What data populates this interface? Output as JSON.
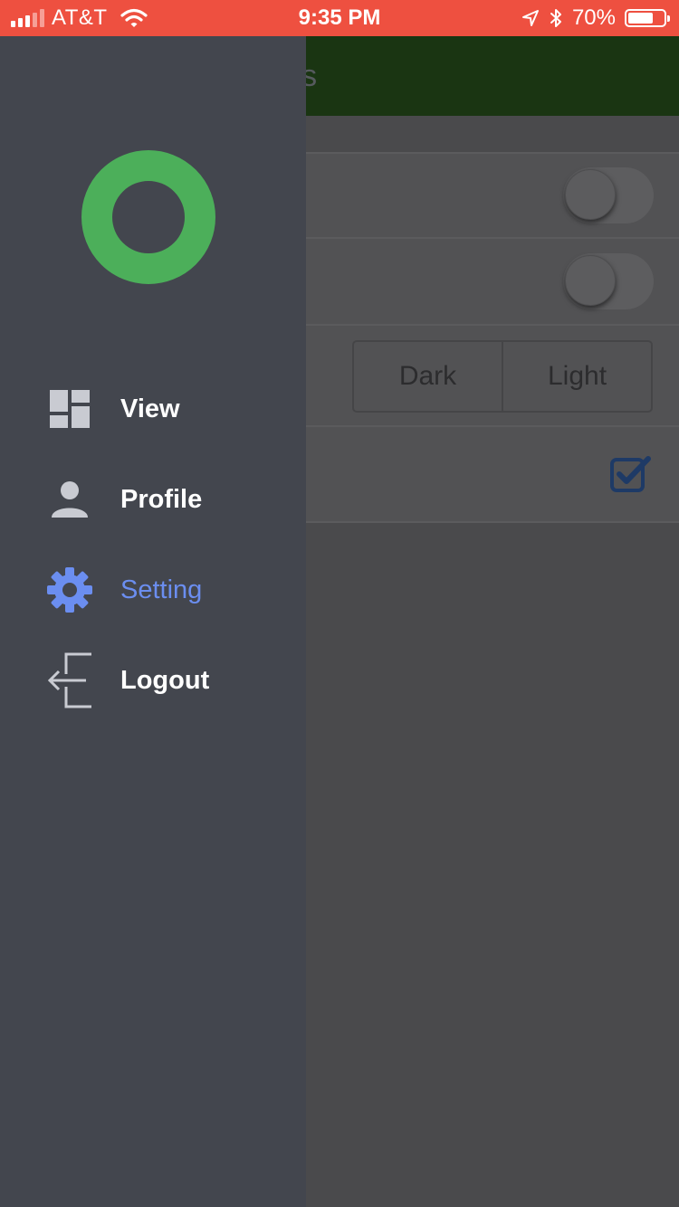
{
  "status_bar": {
    "carrier": "AT&T",
    "time": "9:35 PM",
    "battery_text": "70%",
    "battery_level": 0.7,
    "icons": [
      "signal-icon",
      "wifi-icon",
      "location-icon",
      "bluetooth-icon",
      "battery-icon"
    ]
  },
  "background_page": {
    "title": "Settings",
    "title_visible_text": "ettings",
    "toggle_1": {
      "on": false
    },
    "toggle_2": {
      "on": false
    },
    "theme_segment": {
      "options": [
        "Dark",
        "Light"
      ]
    },
    "checkbox": {
      "checked": true
    }
  },
  "drawer": {
    "logo": "green-ring-logo",
    "items": [
      {
        "label": "View",
        "icon": "dashboard-icon",
        "active": false
      },
      {
        "label": "Profile",
        "icon": "person-icon",
        "active": false
      },
      {
        "label": "Setting",
        "icon": "gear-icon",
        "active": true
      },
      {
        "label": "Logout",
        "icon": "logout-icon",
        "active": false
      }
    ]
  },
  "colors": {
    "status_bar": "#ee5040",
    "drawer_bg": "#43464e",
    "active_item": "#6b8ef0",
    "logo_green": "#4caf5a",
    "header_green": "#1a3512",
    "checkbox_blue": "#1e3a66"
  }
}
